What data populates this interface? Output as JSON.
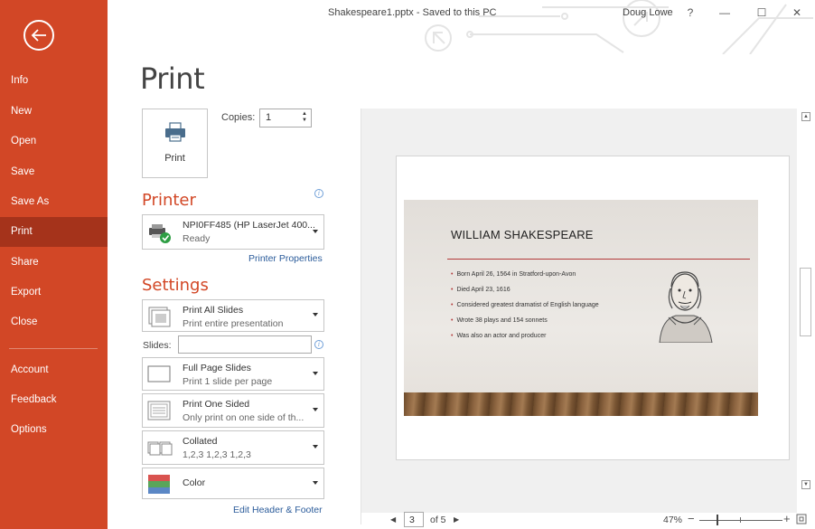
{
  "window": {
    "title": "Shakespeare1.pptx - Saved to this PC",
    "user": "Doug Lowe",
    "help": "?",
    "minimize": "—",
    "maximize": "☐",
    "close": "✕"
  },
  "sidebar": {
    "items": [
      {
        "label": "Info"
      },
      {
        "label": "New"
      },
      {
        "label": "Open"
      },
      {
        "label": "Save"
      },
      {
        "label": "Save As"
      },
      {
        "label": "Print"
      },
      {
        "label": "Share"
      },
      {
        "label": "Export"
      },
      {
        "label": "Close"
      },
      {
        "label": "Account"
      },
      {
        "label": "Feedback"
      },
      {
        "label": "Options"
      }
    ]
  },
  "print": {
    "page_title": "Print",
    "button_label": "Print",
    "copies_label": "Copies:",
    "copies_value": "1"
  },
  "printer": {
    "heading": "Printer",
    "name": "NPI0FF485 (HP LaserJet 400...",
    "status": "Ready",
    "properties_link": "Printer Properties"
  },
  "settings": {
    "heading": "Settings",
    "range": {
      "main": "Print All Slides",
      "sub": "Print entire presentation"
    },
    "slides_label": "Slides:",
    "slides_value": "",
    "layout": {
      "main": "Full Page Slides",
      "sub": "Print 1 slide per page"
    },
    "sides": {
      "main": "Print One Sided",
      "sub": "Only print on one side of th..."
    },
    "collate": {
      "main": "Collated",
      "sub": "1,2,3   1,2,3   1,2,3"
    },
    "color": {
      "main": "Color"
    },
    "header_footer_link": "Edit Header & Footer"
  },
  "preview": {
    "slide_title": "WILLIAM SHAKESPEARE",
    "bullets": [
      "Born April 26, 1564 in Stratford-upon-Avon",
      "Died April 23, 1616",
      "Considered greatest dramatist of English language",
      "Wrote 38 plays and 154 sonnets",
      "Was also an actor and producer"
    ],
    "current_page": "3",
    "page_of": "of 5",
    "zoom": "47%",
    "zoom_level_percent": 47
  },
  "colors": {
    "accent": "#d24726",
    "sidebar_active": "#a5331b",
    "link": "#2a5b9a",
    "slide_rule": "#b33a3a"
  }
}
